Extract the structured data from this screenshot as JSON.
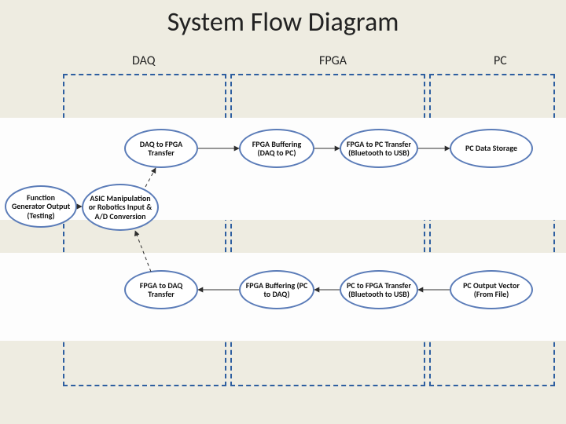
{
  "title": "System Flow Diagram",
  "groups": {
    "daq": "DAQ",
    "fpga": "FPGA",
    "pc": "PC"
  },
  "nodes": {
    "func_gen": "Function Generator Output (Testing)",
    "asic": "ASIC Manipulation or Robotics Input & A/D Conversion",
    "daq_to_fpga": "DAQ to FPGA Transfer",
    "fpga_to_daq": "FPGA to DAQ Transfer",
    "buf_daq_pc": "FPGA Buffering (DAQ to PC)",
    "buf_pc_daq": "FPGA Buffering (PC to DAQ)",
    "fpga_to_pc": "FPGA to PC Transfer (Bluetooth to USB)",
    "pc_to_fpga": "PC to FPGA Transfer (Bluetooth to USB)",
    "pc_storage": "PC Data Storage",
    "pc_output": "PC Output Vector (From File)"
  }
}
